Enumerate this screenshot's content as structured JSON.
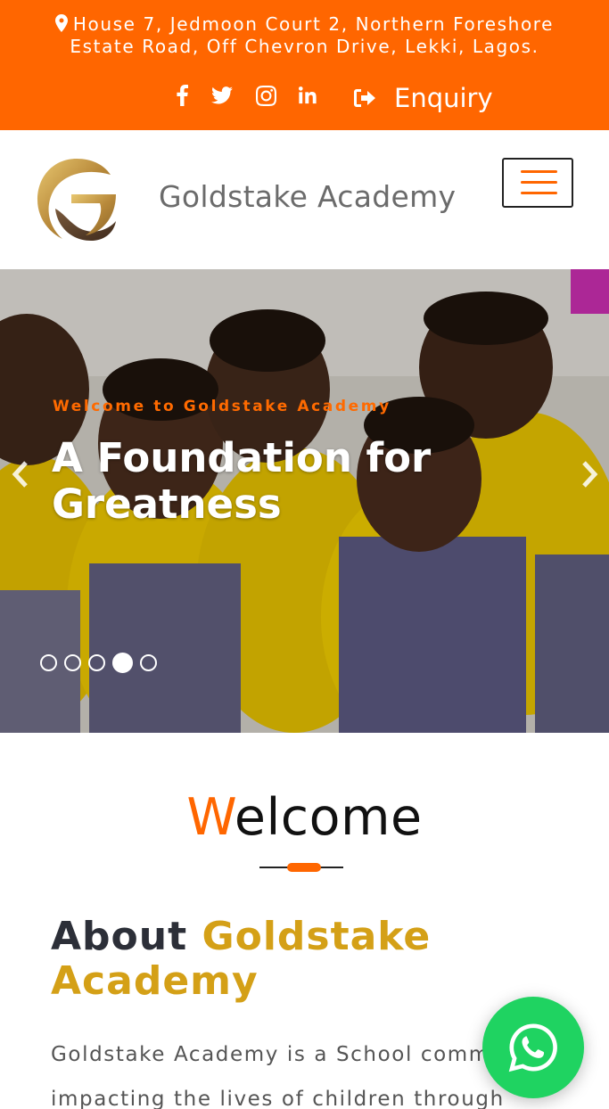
{
  "topbar": {
    "address_line1": "House 7, Jedmoon Court 2, Northern Foreshore",
    "address_line2": "Estate Road, Off Chevron Drive, Lekki, Lagos.",
    "social_icons": [
      "facebook-icon",
      "twitter-icon",
      "instagram-icon",
      "linkedin-icon"
    ],
    "enquiry_label": "Enquiry",
    "background_color": "#ff6600"
  },
  "header": {
    "brand_name": "Goldstake Academy"
  },
  "hero": {
    "eyebrow": "Welcome to Goldstake Academy",
    "headline": "A Foundation for Greatness",
    "slide_count": 5,
    "active_slide": 4
  },
  "welcome": {
    "first_letter": "W",
    "rest": "elcome"
  },
  "about": {
    "prefix": "About",
    "highlight": "Goldstake Academy",
    "paragraph": "Goldstake Academy is a School committed to impacting the lives of children through"
  },
  "colors": {
    "accent": "#ff6600",
    "gold": "#d4a017",
    "whatsapp": "#1fd361"
  }
}
